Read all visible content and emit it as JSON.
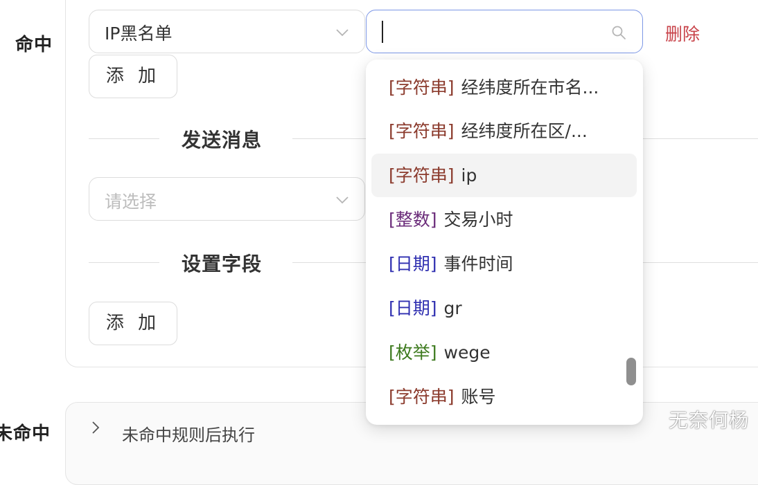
{
  "form": {
    "hit_label": "命中",
    "miss_label": "未命中",
    "condition_type_value": "IP黑名单",
    "search_value": "",
    "delete_label": "删除",
    "add_button_label": "添 加",
    "send_message_title": "发送消息",
    "message_select_placeholder": "请选择",
    "set_fields_title": "设置字段",
    "miss_panel_text": "未命中规则后执行"
  },
  "dropdown": {
    "options": [
      {
        "tag": "[字符串]",
        "name": "经纬度所在市名...",
        "tag_color": "#8b3a2c"
      },
      {
        "tag": "[字符串]",
        "name": "经纬度所在区/...",
        "tag_color": "#8b3a2c"
      },
      {
        "tag": "[字符串]",
        "name": "ip",
        "tag_color": "#8b3a2c",
        "active": true
      },
      {
        "tag": "[整数]",
        "name": "交易小时",
        "tag_color": "#6b2c7a"
      },
      {
        "tag": "[日期]",
        "name": "事件时间",
        "tag_color": "#2f2fb0"
      },
      {
        "tag": "[日期]",
        "name": "gr",
        "tag_color": "#2f2fb0"
      },
      {
        "tag": "[枚举]",
        "name": "wege",
        "tag_color": "#3d7a1e"
      },
      {
        "tag": "[字符串]",
        "name": "账号",
        "tag_color": "#8b3a2c"
      }
    ]
  },
  "icons": {
    "type_select_chevron": "chevron-down-icon",
    "message_select_chevron": "chevron-down-icon",
    "search": "search-icon",
    "miss_panel_chevron": "chevron-right-icon"
  },
  "colors": {
    "delete": "#c8434a",
    "focus_border": "#7b96e6",
    "tag_string": "#8b3a2c",
    "tag_int": "#6b2c7a",
    "tag_date": "#2f2fb0",
    "tag_enum": "#3d7a1e"
  },
  "watermark": "无奈何杨"
}
